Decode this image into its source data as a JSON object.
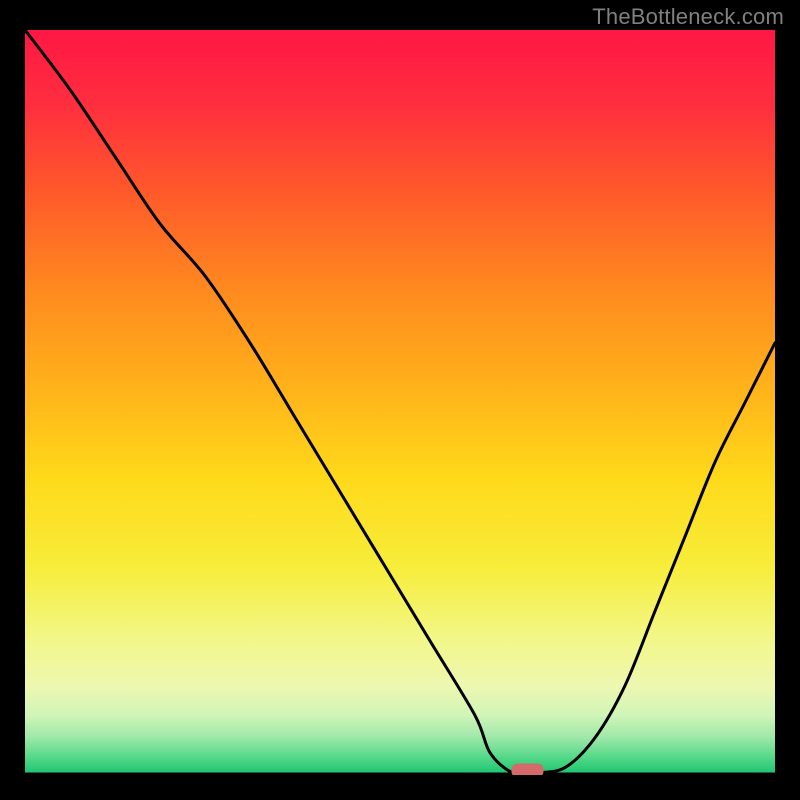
{
  "watermark": "TheBottleneck.com",
  "chart_data": {
    "type": "line",
    "title": "",
    "xlabel": "",
    "ylabel": "",
    "xlim": [
      0,
      100
    ],
    "ylim": [
      0,
      100
    ],
    "gradient_stops": [
      {
        "offset": 0,
        "color": "#ff1744"
      },
      {
        "offset": 10,
        "color": "#ff2e3f"
      },
      {
        "offset": 22,
        "color": "#ff5a2a"
      },
      {
        "offset": 35,
        "color": "#ff8a1f"
      },
      {
        "offset": 48,
        "color": "#ffb21a"
      },
      {
        "offset": 60,
        "color": "#ffd91a"
      },
      {
        "offset": 72,
        "color": "#f7ed3a"
      },
      {
        "offset": 82,
        "color": "#f2f78a"
      },
      {
        "offset": 88,
        "color": "#eef7b0"
      },
      {
        "offset": 92,
        "color": "#d0f5b8"
      },
      {
        "offset": 95,
        "color": "#9de8a8"
      },
      {
        "offset": 97.5,
        "color": "#57d98a"
      },
      {
        "offset": 100,
        "color": "#16c46f"
      }
    ],
    "series": [
      {
        "name": "curve",
        "x": [
          0,
          6,
          12,
          18,
          24,
          30,
          36,
          42,
          48,
          54,
          60,
          62,
          65,
          68,
          72,
          76,
          80,
          84,
          88,
          92,
          96,
          100
        ],
        "y": [
          100,
          92,
          83,
          74,
          67,
          58,
          48,
          38,
          28,
          18,
          8,
          3,
          0.3,
          0.3,
          1,
          5,
          12,
          22,
          32,
          42,
          50,
          58
        ]
      }
    ],
    "marker": {
      "x": 67,
      "y": 0.6,
      "color": "#d46a6a"
    }
  }
}
